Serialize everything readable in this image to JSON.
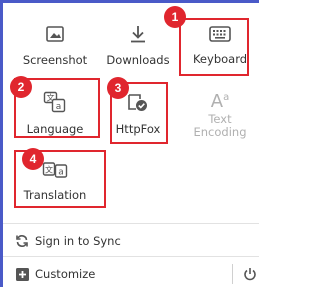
{
  "panel": {
    "tiles": {
      "screenshot": "Screenshot",
      "downloads": "Downloads",
      "keyboard": "Keyboard",
      "language": "Language",
      "httpfox": "HttpFox",
      "text_encoding": "Text\nEncoding",
      "translation": "Translation"
    },
    "footer": {
      "sign_in": "Sign in to Sync",
      "customize": "Customize"
    }
  },
  "annotations": [
    "1",
    "2",
    "3",
    "4"
  ],
  "colors": {
    "highlight": "#e0262e",
    "frame_accent": "#4a5ac8"
  },
  "icons": {
    "screenshot": "screenshot-icon",
    "downloads": "download-arrow-icon",
    "keyboard": "keyboard-icon",
    "language": "language-icon",
    "httpfox": "httpfox-icon",
    "text_encoding": "text-encoding-icon",
    "translation": "translation-icon",
    "sync": "sync-icon",
    "customize": "plus-square-icon",
    "power": "power-icon"
  }
}
